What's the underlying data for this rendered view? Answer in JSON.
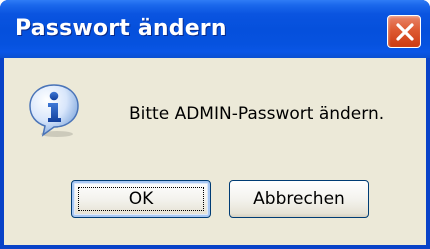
{
  "dialog": {
    "title": "Passwort ändern",
    "message": "Bitte ADMIN-Passwort ändern.",
    "icon": "information-icon",
    "buttons": {
      "ok_label": "OK",
      "cancel_label": "Abbrechen"
    },
    "colors": {
      "titlebar": "#0550dc",
      "close_button": "#de5a32",
      "client_background": "#ece9d8",
      "button_border": "#003c74"
    }
  }
}
